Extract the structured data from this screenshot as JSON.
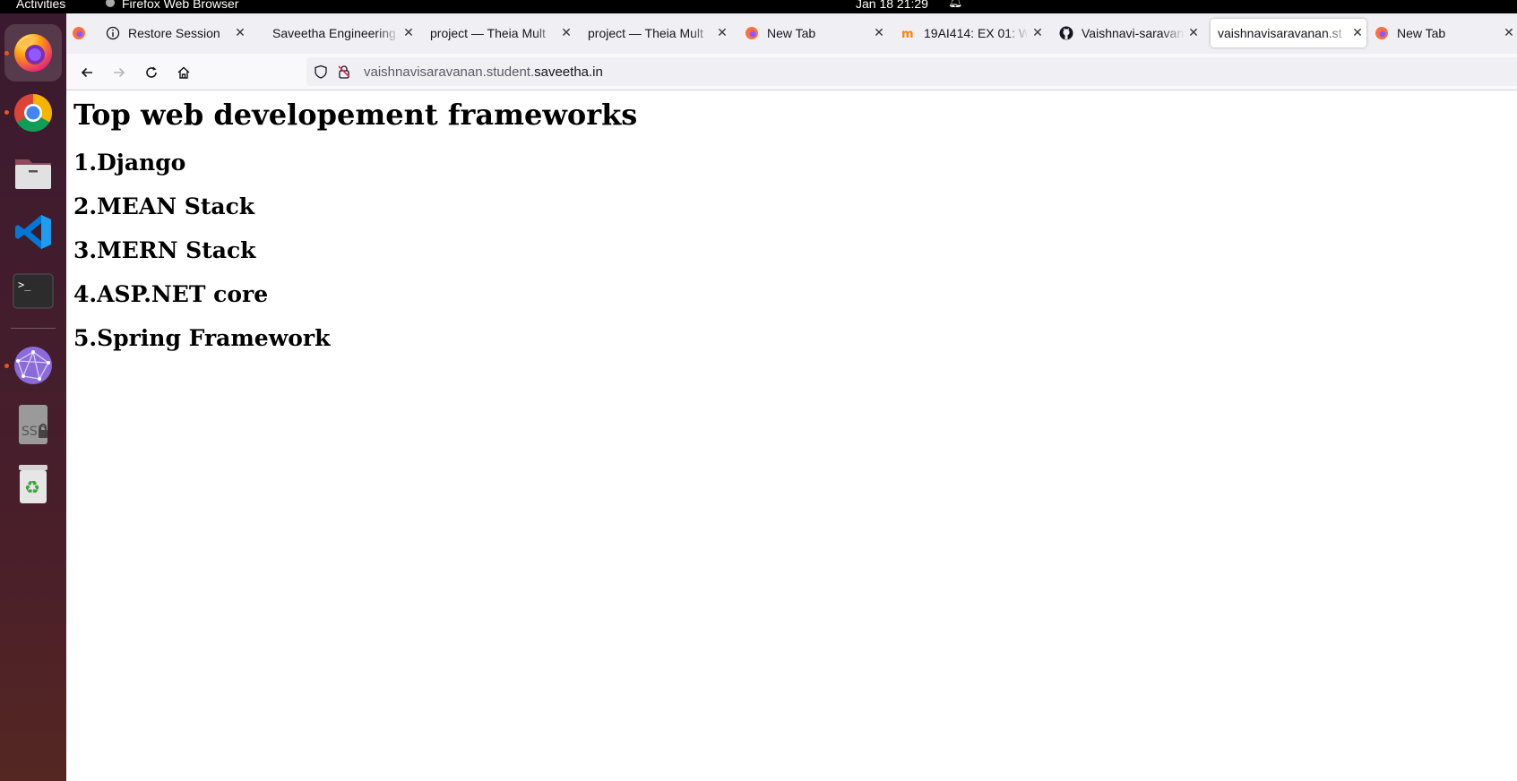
{
  "system": {
    "activities": "Activities",
    "app_name": "Firefox Web Browser",
    "clock": "Jan 18  21:29"
  },
  "dock": {
    "apps": [
      "firefox-icon",
      "chrome-icon",
      "files-icon",
      "vscode-icon",
      "terminal-icon",
      "network-icon",
      "ssd-drive-icon",
      "trash-icon"
    ],
    "running": [
      "firefox-icon",
      "chrome-icon",
      "network-icon"
    ]
  },
  "tabs": [
    {
      "label": "",
      "icon": "firefox-icon"
    },
    {
      "label": "Restore Session",
      "icon": "info-icon"
    },
    {
      "label": "Saveetha Engineering",
      "icon": ""
    },
    {
      "label": "project — Theia Mult",
      "icon": ""
    },
    {
      "label": "project — Theia Mult",
      "icon": ""
    },
    {
      "label": "New Tab",
      "icon": "firefox-icon"
    },
    {
      "label": "19AI414: EX 01: W",
      "icon": "moodle-icon"
    },
    {
      "label": "Vaishnavi-saravan",
      "icon": "github-icon"
    },
    {
      "label": "vaishnavisaravanan.st",
      "icon": "",
      "selected": true
    },
    {
      "label": "New Tab",
      "icon": "firefox-icon"
    }
  ],
  "address_bar": {
    "url_prefix": "vaishnavisaravanan.student.",
    "url_domain": "saveetha.in"
  },
  "page": {
    "heading": "Top web developement frameworks",
    "items": [
      "1.Django",
      "2.MEAN Stack",
      "3.MERN Stack",
      "4.ASP.NET core",
      "5.Spring Framework"
    ]
  },
  "colors": {
    "accent": "#e95420",
    "dock_top": "#3a1a2f",
    "dock_bottom": "#552722"
  }
}
